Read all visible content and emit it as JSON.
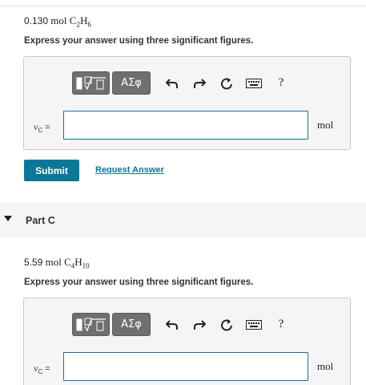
{
  "partB": {
    "problem": {
      "amount": "0.130",
      "unit": "mol",
      "formula_c": "C",
      "formula_c_sub": "2",
      "formula_h": "H",
      "formula_h_sub": "6"
    },
    "instructions": "Express your answer using three significant figures.",
    "var_label": {
      "symbol": "ν",
      "sub": "C",
      "eq": "="
    },
    "answer_value": "",
    "unit": "mol",
    "submit_label": "Submit",
    "request_label": "Request Answer"
  },
  "partC": {
    "title": "Part C",
    "problem": {
      "amount": "5.59",
      "unit": "mol",
      "formula_c": "C",
      "formula_c_sub": "4",
      "formula_h": "H",
      "formula_h_sub": "10"
    },
    "instructions": "Express your answer using three significant figures.",
    "var_label": {
      "symbol": "ν",
      "sub": "C",
      "eq": "="
    },
    "answer_value": "",
    "unit": "mol"
  },
  "toolbar": {
    "greek_label": "ΑΣφ",
    "help_label": "?",
    "icons": [
      "templates-icon",
      "greek-letters-icon",
      "undo-icon",
      "redo-icon",
      "reset-icon",
      "keyboard-icon",
      "help-icon"
    ]
  },
  "colors": {
    "accent": "#0a7896",
    "toolbar_button": "#6f6f6f",
    "panel_bg": "#f5f5f5"
  }
}
